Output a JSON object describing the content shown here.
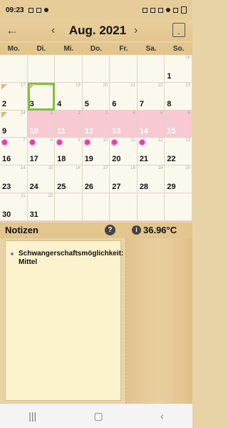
{
  "status": {
    "time": "09:23"
  },
  "header": {
    "title": "Aug. 2021"
  },
  "weekdays": [
    "Mo.",
    "Di.",
    "Mi.",
    "Do.",
    "Fr.",
    "Sa.",
    "So."
  ],
  "weeks": [
    [
      {
        "num": "",
        "small": ""
      },
      {
        "num": "",
        "small": ""
      },
      {
        "num": "",
        "small": ""
      },
      {
        "num": "",
        "small": ""
      },
      {
        "num": "",
        "small": ""
      },
      {
        "num": "",
        "small": ""
      },
      {
        "num": "1",
        "small": "16"
      }
    ],
    [
      {
        "num": "2",
        "small": "17"
      },
      {
        "num": "3",
        "small": "18"
      },
      {
        "num": "4",
        "small": "19"
      },
      {
        "num": "5",
        "small": "20"
      },
      {
        "num": "6",
        "small": "21"
      },
      {
        "num": "7",
        "small": "22"
      },
      {
        "num": "8",
        "small": "23"
      }
    ],
    [
      {
        "num": "9",
        "small": "24"
      },
      {
        "num": "10",
        "small": "1"
      },
      {
        "num": "11",
        "small": "2"
      },
      {
        "num": "12",
        "small": "3"
      },
      {
        "num": "13",
        "small": "4"
      },
      {
        "num": "14",
        "small": "5"
      },
      {
        "num": "15",
        "small": "6"
      }
    ],
    [
      {
        "num": "16",
        "small": "7"
      },
      {
        "num": "17",
        "small": "8"
      },
      {
        "num": "18",
        "small": "9"
      },
      {
        "num": "19",
        "small": "10"
      },
      {
        "num": "20",
        "small": "11"
      },
      {
        "num": "21",
        "small": "12"
      },
      {
        "num": "22",
        "small": "13"
      }
    ],
    [
      {
        "num": "23",
        "small": "14"
      },
      {
        "num": "24",
        "small": "15"
      },
      {
        "num": "25",
        "small": "16"
      },
      {
        "num": "26",
        "small": "17"
      },
      {
        "num": "27",
        "small": "18"
      },
      {
        "num": "28",
        "small": "19"
      },
      {
        "num": "29",
        "small": "20"
      }
    ],
    [
      {
        "num": "30",
        "small": "21"
      },
      {
        "num": "31",
        "small": "22"
      },
      {
        "num": "",
        "small": ""
      },
      {
        "num": "",
        "small": ""
      },
      {
        "num": "",
        "small": ""
      },
      {
        "num": "",
        "small": ""
      },
      {
        "num": "",
        "small": ""
      }
    ]
  ],
  "notes": {
    "label": "Notizen",
    "temperature": "36.96°C",
    "item": "Schwangerschaftsmöglichkeit: Mittel"
  },
  "icons": {
    "help": "?",
    "info": "i",
    "back": "←",
    "prev": "‹",
    "next": "›"
  }
}
